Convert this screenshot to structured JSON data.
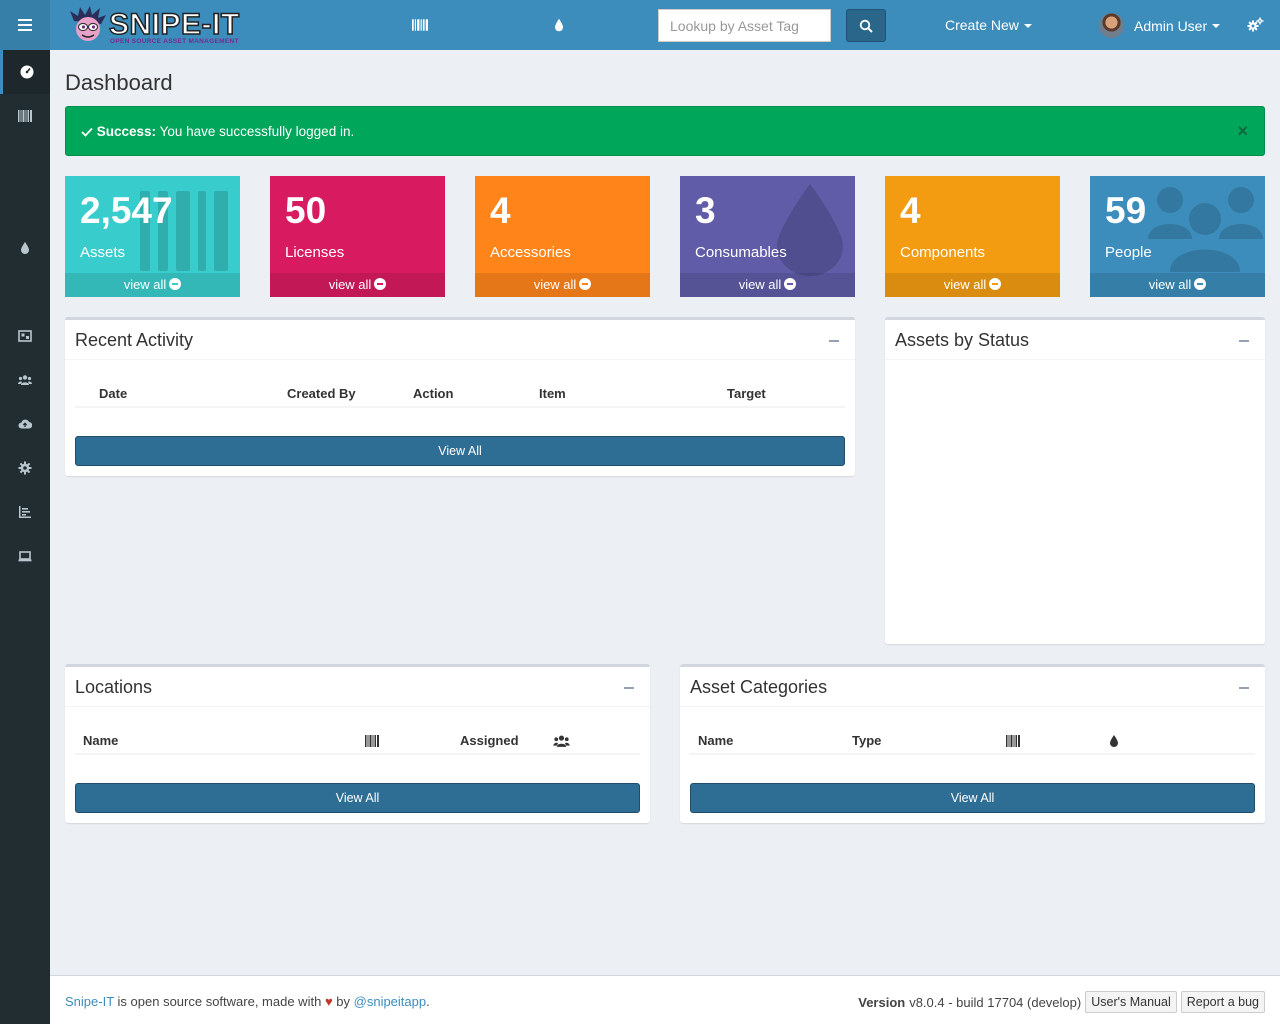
{
  "header": {
    "logo_text": "SNIPE-IT",
    "logo_subtext": "OPEN SOURCE ASSET MANAGEMENT",
    "lookup_placeholder": "Lookup by Asset Tag",
    "create_new": "Create New",
    "user_name": "Admin User"
  },
  "sidebar": {
    "items": [
      "menu-icon",
      "dashboard-icon",
      "barcode-icon",
      "tint-icon",
      "map-icon",
      "users-icon",
      "cloud-upload-icon",
      "cog-icon",
      "chart-icon",
      "laptop-icon"
    ]
  },
  "page": {
    "title": "Dashboard"
  },
  "alert": {
    "strong": "Success:",
    "message": "You have successfully logged in.",
    "close": "×"
  },
  "tiles": [
    {
      "count": "2,547",
      "label": "Assets",
      "link": "view all",
      "color": "#39cccc"
    },
    {
      "count": "50",
      "label": "Licenses",
      "link": "view all",
      "color": "#d81b60"
    },
    {
      "count": "4",
      "label": "Accessories",
      "link": "view all",
      "color": "#ff851b"
    },
    {
      "count": "3",
      "label": "Consumables",
      "link": "view all",
      "color": "#605ca8"
    },
    {
      "count": "4",
      "label": "Components",
      "link": "view all",
      "color": "#f39c12"
    },
    {
      "count": "59",
      "label": "People",
      "link": "view all",
      "color": "#3c8dbc"
    }
  ],
  "recent_activity": {
    "title": "Recent Activity",
    "columns": [
      "Date",
      "Created By",
      "Action",
      "Item",
      "Target"
    ],
    "button": "View All"
  },
  "assets_by_status": {
    "title": "Assets by Status"
  },
  "locations": {
    "title": "Locations",
    "columns": [
      "Name",
      "Assigned"
    ],
    "button": "View All"
  },
  "asset_categories": {
    "title": "Asset Categories",
    "columns": [
      "Name",
      "Type"
    ],
    "button": "View All"
  },
  "footer": {
    "brand": "Snipe-IT",
    "text1": "is open source software, made with",
    "text2": "by",
    "handle": "@snipeitapp",
    "period": ".",
    "version_label": "Version",
    "version": "v8.0.4 - build 17704 (develop)",
    "manual": "User's Manual",
    "report": "Report a bug"
  }
}
